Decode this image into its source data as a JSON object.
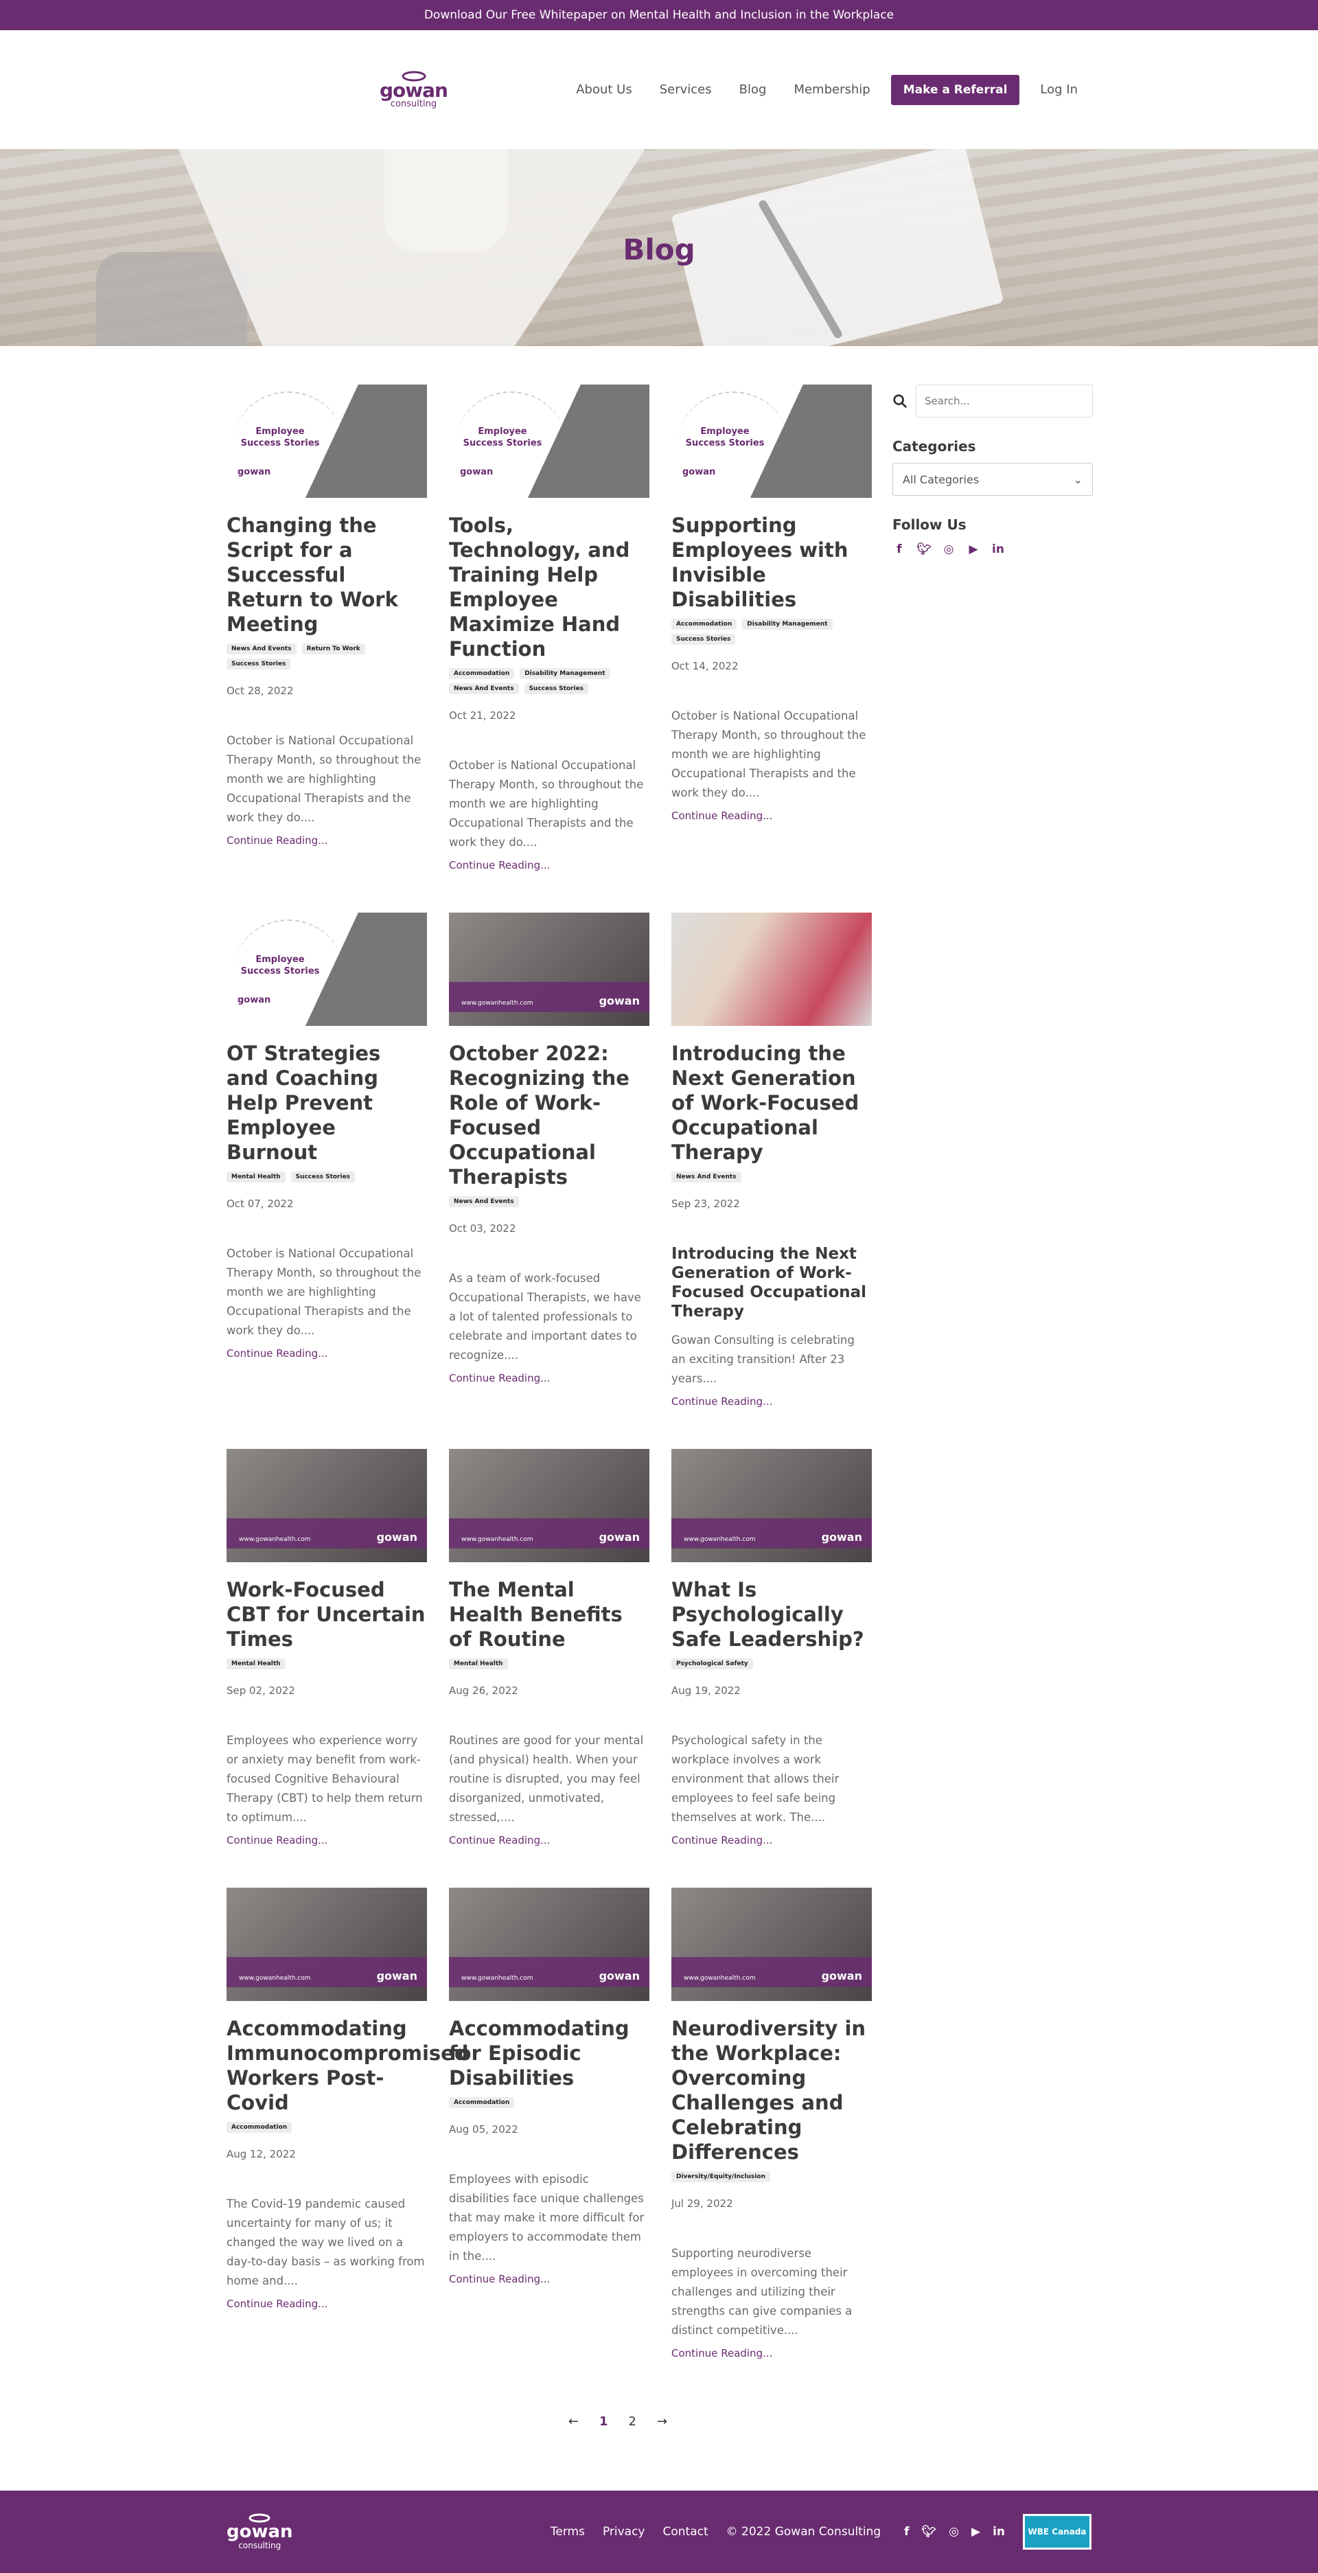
{
  "announcement": "Download Our Free Whitepaper on Mental Health and Inclusion in the Workplace",
  "brand": {
    "name": "gowan",
    "sub": "consulting",
    "accent": "#6a2c70"
  },
  "nav": {
    "about": "About Us",
    "services": "Services",
    "blog": "Blog",
    "membership": "Membership",
    "referral": "Make a Referral",
    "login": "Log In"
  },
  "hero": {
    "title": "Blog"
  },
  "story_badge": "Employee Success Stories",
  "photo_url": "www.gowanhealth.com",
  "posts": [
    {
      "title": "Changing the Script for a Successful Return to Work Meeting",
      "tags": [
        "News And Events",
        "Return To Work",
        "Success Stories"
      ],
      "date": "Oct 28, 2022",
      "excerpt": "October is National Occupational Therapy Month, so throughout the month we are highlighting Occupational Therapists and the work they do....",
      "more": "Continue Reading..."
    },
    {
      "title": "Tools, Technology, and Training Help Employee Maximize Hand Function",
      "tags": [
        "Accommodation",
        "Disability Management",
        "News And Events",
        "Success Stories"
      ],
      "date": "Oct 21, 2022",
      "excerpt": "October is National Occupational Therapy Month, so throughout the month we are highlighting Occupational Therapists and the work they do....",
      "more": "Continue Reading..."
    },
    {
      "title": "Supporting Employees with Invisible Disabilities",
      "tags": [
        "Accommodation",
        "Disability Management",
        "Success Stories"
      ],
      "date": "Oct 14, 2022",
      "excerpt": "October is National Occupational Therapy Month, so throughout the month we are highlighting Occupational Therapists and the work they do....",
      "more": "Continue Reading..."
    },
    {
      "title": "OT Strategies and Coaching Help Prevent Employee Burnout",
      "tags": [
        "Mental Health",
        "Success Stories"
      ],
      "date": "Oct 07, 2022",
      "excerpt": "October is National Occupational Therapy Month, so throughout the month we are highlighting Occupational Therapists and the work they do....",
      "more": "Continue Reading..."
    },
    {
      "title": "October 2022: Recognizing the Role of Work-Focused Occupational Therapists",
      "tags": [
        "News And Events"
      ],
      "date": "Oct 03, 2022",
      "excerpt": "As a team of work-focused Occupational Therapists, we have a lot of talented professionals to celebrate and important dates to recognize....",
      "more": "Continue Reading..."
    },
    {
      "title": "Introducing the Next Generation of Work-Focused Occupational Therapy",
      "tags": [
        "News And Events"
      ],
      "date": "Sep 23, 2022",
      "subheading": "Introducing the Next Generation of Work-Focused Occupational Therapy",
      "excerpt": "Gowan Consulting is celebrating an exciting transition! After 23 years....",
      "more": "Continue Reading..."
    },
    {
      "title": "Work-Focused CBT for Uncertain Times",
      "tags": [
        "Mental Health"
      ],
      "date": "Sep 02, 2022",
      "excerpt": "Employees who experience worry or anxiety may benefit from work-focused Cognitive Behavioural Therapy (CBT) to help them return to optimum....",
      "more": "Continue Reading..."
    },
    {
      "title": "The Mental Health Benefits of Routine",
      "tags": [
        "Mental Health"
      ],
      "date": "Aug 26, 2022",
      "excerpt": "Routines are good for your mental (and physical) health. When your routine is disrupted, you may feel disorganized, unmotivated, stressed,....",
      "more": "Continue Reading..."
    },
    {
      "title": "What Is Psychologically Safe Leadership?",
      "tags": [
        "Psychological Safety"
      ],
      "date": "Aug 19, 2022",
      "excerpt": "Psychological safety in the workplace involves a work environment that allows their employees to feel safe being themselves at work. The....",
      "more": "Continue Reading..."
    },
    {
      "title": "Accommodating Immunocompromised Workers Post-Covid",
      "tags": [
        "Accommodation"
      ],
      "date": "Aug 12, 2022",
      "excerpt": "The Covid-19 pandemic caused uncertainty for many of us; it changed the way we lived on a day-to-day basis – as working from home and....",
      "more": "Continue Reading..."
    },
    {
      "title": "Accommodating for Episodic Disabilities",
      "tags": [
        "Accommodation"
      ],
      "date": "Aug 05, 2022",
      "excerpt": "Employees with episodic disabilities face unique challenges that may make it more difficult for employers to accommodate them in the....",
      "more": "Continue Reading..."
    },
    {
      "title": "Neurodiversity in the Workplace: Overcoming Challenges and Celebrating Differences",
      "tags": [
        "Diversity/Equity/Inclusion"
      ],
      "date": "Jul 29, 2022",
      "excerpt": "Supporting neurodiverse employees in overcoming their challenges and utilizing their strengths can give companies a distinct competitive....",
      "more": "Continue Reading..."
    }
  ],
  "sidebar": {
    "search_placeholder": "Search...",
    "categories_heading": "Categories",
    "categories_selected": "All Categories",
    "follow_heading": "Follow Us"
  },
  "pager": {
    "page1": "1",
    "page2": "2"
  },
  "footer": {
    "terms": "Terms",
    "privacy": "Privacy",
    "contact": "Contact",
    "copyright": "© 2022 Gowan Consulting",
    "badge": "WBE Canada"
  }
}
